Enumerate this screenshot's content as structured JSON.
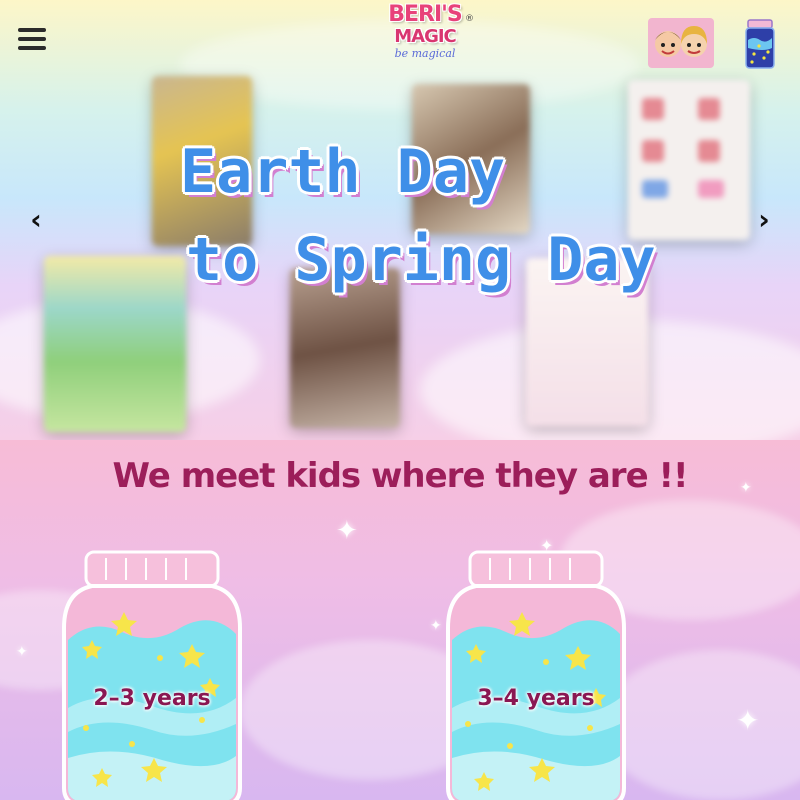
{
  "header": {
    "brand_line1": "BERI'S",
    "brand_line2": "MAGIC",
    "brand_tagline": "be magical",
    "registered_mark": "®"
  },
  "hero": {
    "title_line1": "Earth Day",
    "title_line2": "to Spring Day",
    "prev_arrow": "‹",
    "next_arrow": "›"
  },
  "section": {
    "title": "We meet kids where they are !!",
    "jars": [
      {
        "label": "2–3 years"
      },
      {
        "label": "3–4 years"
      }
    ]
  },
  "icons": {
    "menu": "hamburger-menu-icon",
    "kids": "kids-avatar-icon",
    "jar": "magic-jar-icon",
    "prev": "chevron-left-icon",
    "next": "chevron-right-icon"
  },
  "colors": {
    "brand_pink": "#e8427a",
    "title_blue": "#3f8fe8",
    "section_title": "#9c1e5a",
    "jar_label": "#8a1752"
  }
}
